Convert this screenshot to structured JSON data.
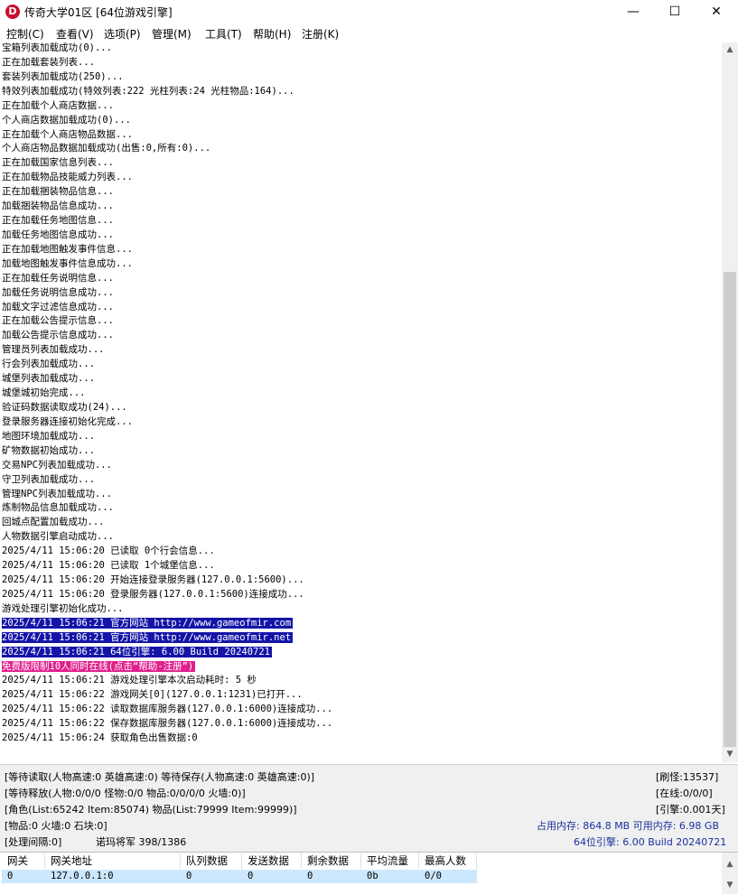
{
  "window": {
    "icon_letter": "D",
    "title": "传奇大学01区 [64位游戏引擎]",
    "minimize_symbol": "—",
    "maximize_symbol": "☐",
    "close_symbol": "✕"
  },
  "menu": [
    "控制(C)",
    "查看(V)",
    "选项(P)",
    "管理(M)",
    "工具(T)",
    "帮助(H)",
    "注册(K)"
  ],
  "log": [
    {
      "text": "宝箱列表加载成功(0)...",
      "hl": ""
    },
    {
      "text": "正在加载套装列表...",
      "hl": ""
    },
    {
      "text": "套装列表加载成功(250)...",
      "hl": ""
    },
    {
      "text": "特效列表加载成功(特效列表:222 光柱列表:24 光柱物品:164)...",
      "hl": ""
    },
    {
      "text": "正在加载个人商店数据...",
      "hl": ""
    },
    {
      "text": "个人商店数据加载成功(0)...",
      "hl": ""
    },
    {
      "text": "正在加载个人商店物品数据...",
      "hl": ""
    },
    {
      "text": "个人商店物品数据加载成功(出售:0,所有:0)...",
      "hl": ""
    },
    {
      "text": "正在加载国家信息列表...",
      "hl": ""
    },
    {
      "text": "正在加载物品技能威力列表...",
      "hl": ""
    },
    {
      "text": "正在加载捆装物品信息...",
      "hl": ""
    },
    {
      "text": "加载捆装物品信息成功...",
      "hl": ""
    },
    {
      "text": "正在加载任务地图信息...",
      "hl": ""
    },
    {
      "text": "加载任务地图信息成功...",
      "hl": ""
    },
    {
      "text": "正在加载地图触发事件信息...",
      "hl": ""
    },
    {
      "text": "加载地图触发事件信息成功...",
      "hl": ""
    },
    {
      "text": "正在加载任务说明信息...",
      "hl": ""
    },
    {
      "text": "加载任务说明信息成功...",
      "hl": ""
    },
    {
      "text": "加载文字过滤信息成功...",
      "hl": ""
    },
    {
      "text": "正在加载公告提示信息...",
      "hl": ""
    },
    {
      "text": "加载公告提示信息成功...",
      "hl": ""
    },
    {
      "text": "管理员列表加载成功...",
      "hl": ""
    },
    {
      "text": "行会列表加载成功...",
      "hl": ""
    },
    {
      "text": "城堡列表加载成功...",
      "hl": ""
    },
    {
      "text": "城堡城初始完成...",
      "hl": ""
    },
    {
      "text": "验证码数据读取成功(24)...",
      "hl": ""
    },
    {
      "text": "登录服务器连接初始化完成...",
      "hl": ""
    },
    {
      "text": "地图环境加载成功...",
      "hl": ""
    },
    {
      "text": "矿物数据初始成功...",
      "hl": ""
    },
    {
      "text": "交易NPC列表加载成功...",
      "hl": ""
    },
    {
      "text": "守卫列表加载成功...",
      "hl": ""
    },
    {
      "text": "管理NPC列表加载成功...",
      "hl": ""
    },
    {
      "text": "炼制物品信息加载成功...",
      "hl": ""
    },
    {
      "text": "回城点配置加载成功...",
      "hl": ""
    },
    {
      "text": "人物数据引擎启动成功...",
      "hl": ""
    },
    {
      "text": "2025/4/11 15:06:20 已读取 0个行会信息...",
      "hl": ""
    },
    {
      "text": "2025/4/11 15:06:20 已读取 1个城堡信息...",
      "hl": ""
    },
    {
      "text": "2025/4/11 15:06:20 开始连接登录服务器(127.0.0.1:5600)...",
      "hl": ""
    },
    {
      "text": "2025/4/11 15:06:20 登录服务器(127.0.0.1:5600)连接成功...",
      "hl": ""
    },
    {
      "text": "游戏处理引擎初始化成功...",
      "hl": ""
    },
    {
      "text": "2025/4/11 15:06:21 官方网站 http://www.gameofmir.com",
      "hl": "blue"
    },
    {
      "text": "2025/4/11 15:06:21 官方网站 http://www.gameofmir.net",
      "hl": "blue"
    },
    {
      "text": "2025/4/11 15:06:21 64位引擎: 6.00 Build 20240721",
      "hl": "blue"
    },
    {
      "text": "免费版限制10人同时在线(点击“帮助-注册”)",
      "hl": "pink"
    },
    {
      "text": "2025/4/11 15:06:21 游戏处理引擎本次启动耗时: 5 秒",
      "hl": ""
    },
    {
      "text": "2025/4/11 15:06:22 游戏网关[0](127.0.0.1:1231)已打开...",
      "hl": ""
    },
    {
      "text": "2025/4/11 15:06:22 读取数据库服务器(127.0.0.1:6000)连接成功...",
      "hl": ""
    },
    {
      "text": "2025/4/11 15:06:22 保存数据库服务器(127.0.0.1:6000)连接成功...",
      "hl": ""
    },
    {
      "text": "2025/4/11 15:06:24 获取角色出售数据:0",
      "hl": ""
    }
  ],
  "scroll": {
    "up_symbol": "▲",
    "down_symbol": "▼"
  },
  "status": {
    "row1_left": "[等待读取(人物高速:0 英雄高速:0) 等待保存(人物高速:0 英雄高速:0)]",
    "row1_right": "[刷怪:13537]",
    "row2_left": "[等待释放(人物:0/0/0 怪物:0/0 物品:0/0/0/0 火墙:0)]",
    "row2_right": "[在线:0/0/0]",
    "row3_left": "[角色(List:65242 Item:85074) 物品(List:79999 Item:99999)]",
    "row3_right": "[引擎:0.001天]",
    "row4_left": "[物品:0 火墙:0 石块:0]",
    "row4_right": "占用内存: 864.8 MB 可用内存: 6.98 GB",
    "row5_left": "[处理间隔:0]",
    "row5_mid": "诺玛将军 398/1386",
    "row5_right": "64位引擎: 6.00 Build 20240721"
  },
  "gateway_table": {
    "headers": [
      "网关",
      "网关地址",
      "队列数据",
      "发送数据",
      "剩余数据",
      "平均流量",
      "最高人数"
    ],
    "rows": [
      [
        "0",
        "127.0.0.1:0",
        "0",
        "0",
        "0",
        "0b",
        "0/0"
      ]
    ]
  },
  "colors": {
    "highlight_blue": "#1414a8",
    "highlight_pink": "#e0208c",
    "status_blue": "#1a2f9e",
    "row_selected": "#cce8ff"
  }
}
